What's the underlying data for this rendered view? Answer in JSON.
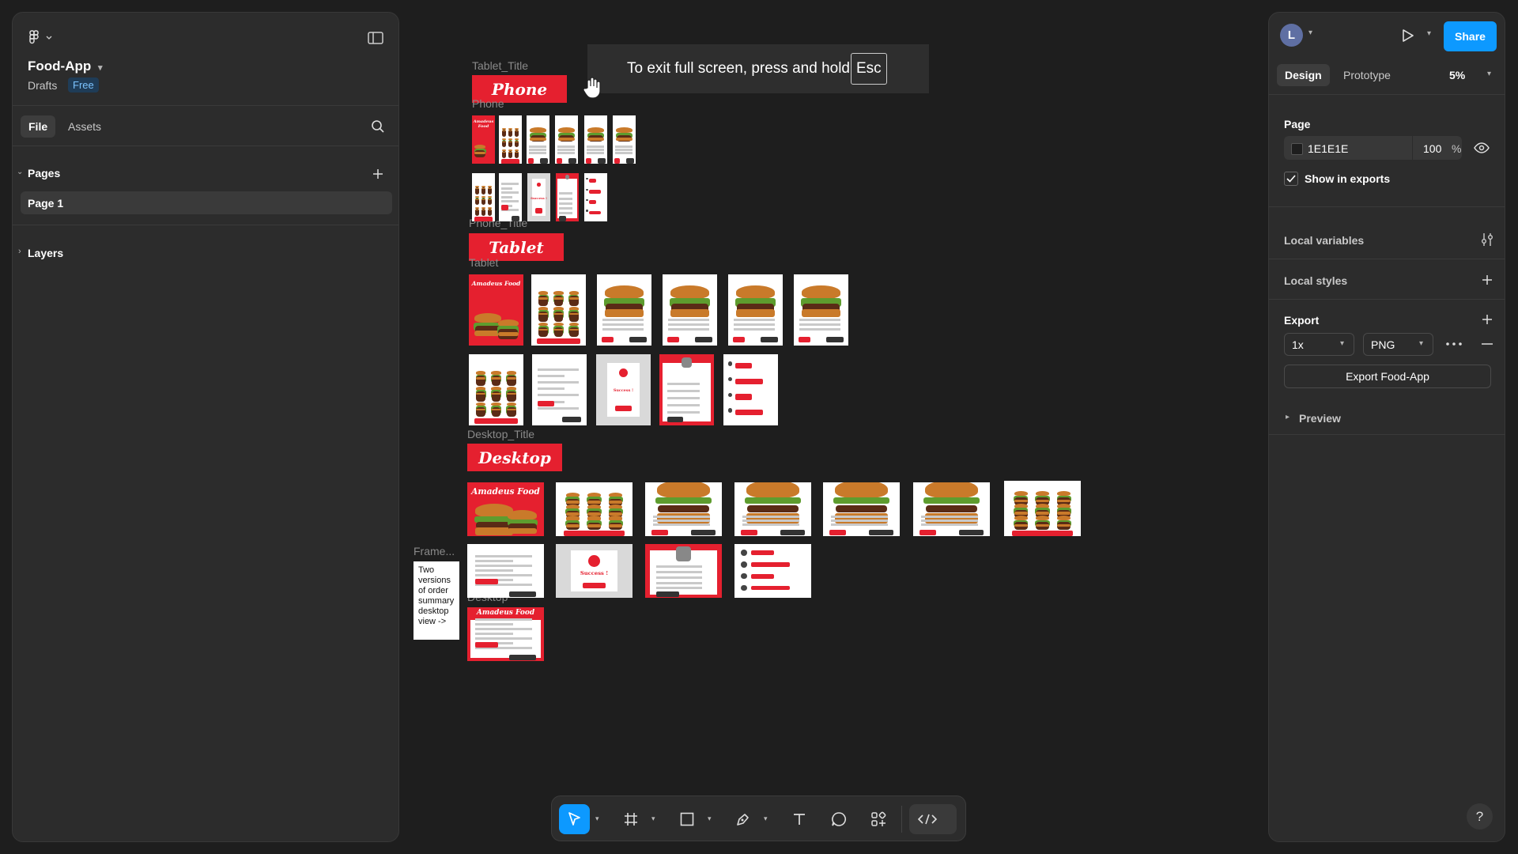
{
  "left_panel": {
    "file_name": "Food-App",
    "location": "Drafts",
    "plan_badge": "Free",
    "tabs": [
      "File",
      "Assets"
    ],
    "pages_heading": "Pages",
    "pages": [
      "Page 1"
    ],
    "layers_heading": "Layers"
  },
  "right_panel": {
    "avatar_initial": "L",
    "share_label": "Share",
    "tabs": [
      "Design",
      "Prototype"
    ],
    "zoom": "5%",
    "page_heading": "Page",
    "fill_hex": "1E1E1E",
    "fill_opacity": "100",
    "fill_unit": "%",
    "show_in_exports": "Show in exports",
    "local_variables": "Local variables",
    "local_styles": "Local styles",
    "export_heading": "Export",
    "export_scale": "1x",
    "export_format": "PNG",
    "export_button": "Export Food-App",
    "preview": "Preview"
  },
  "canvas": {
    "fullscreen_hint": "To exit full screen, press and hold",
    "fullscreen_key": "Esc",
    "labels": {
      "tablet_title": "Tablet_Title",
      "phone": "Phone",
      "phone_title": "Phone_Title",
      "tablet": "Tablet",
      "desktop_title": "Desktop_Title",
      "frame": "Frame...",
      "desktop": "Desktop"
    },
    "banners": {
      "phone": "Phone",
      "tablet": "Tablet",
      "desktop": "Desktop"
    },
    "brand_text": "Amadeus Food",
    "success_text": "Success !",
    "note_text": "Two versions of order summary desktop view ->"
  },
  "colors": {
    "canvas_bg": "#1e1e1e",
    "accent_red": "#e5202f",
    "share_blue": "#0d99ff"
  }
}
